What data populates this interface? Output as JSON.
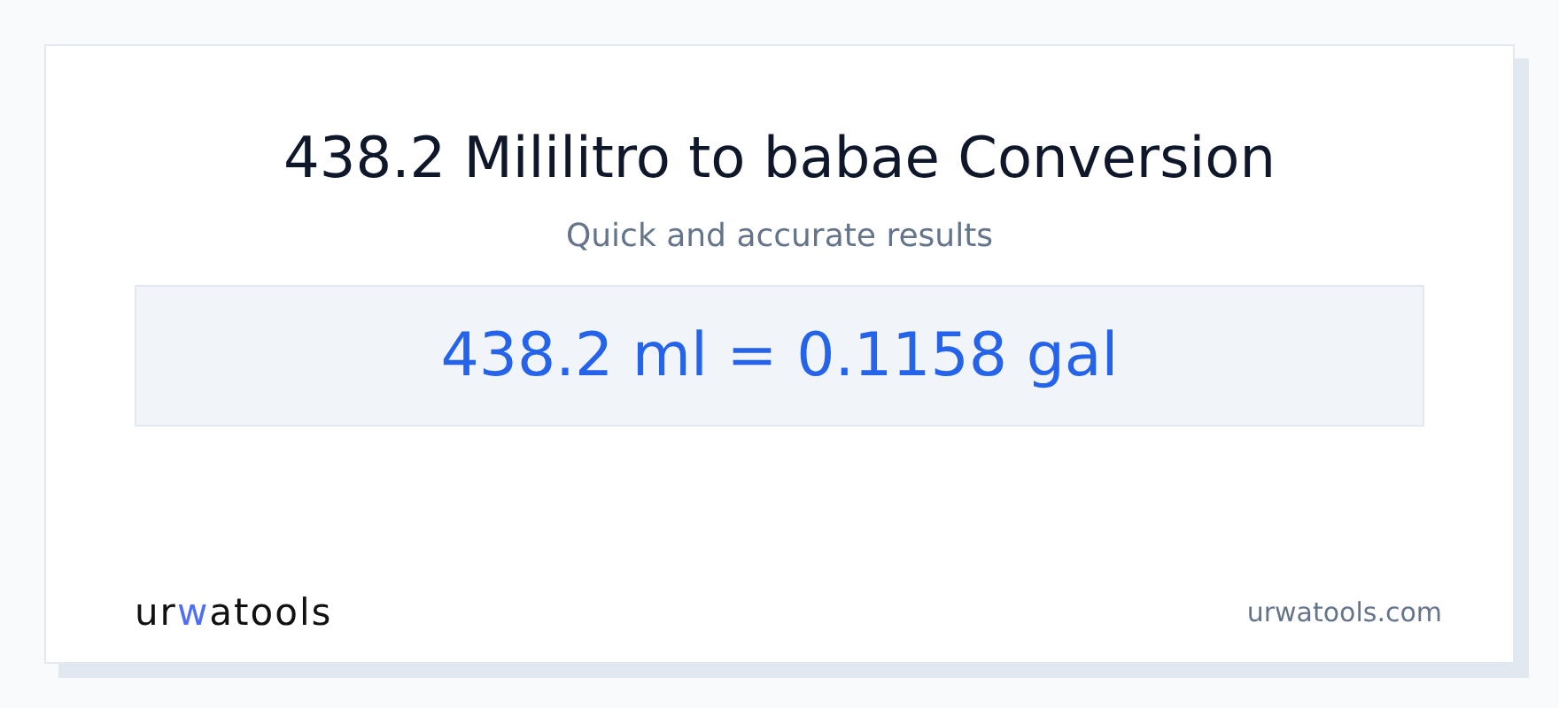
{
  "title": "438.2 Mililitro to babae Conversion",
  "subtitle": "Quick and accurate results",
  "result": "438.2 ml = 0.1158 gal",
  "logo": {
    "parts": [
      {
        "text": "ur",
        "accent": false
      },
      {
        "text": "w",
        "accent": true
      },
      {
        "text": "atools",
        "accent": false
      }
    ]
  },
  "site": "urwatools.com"
}
